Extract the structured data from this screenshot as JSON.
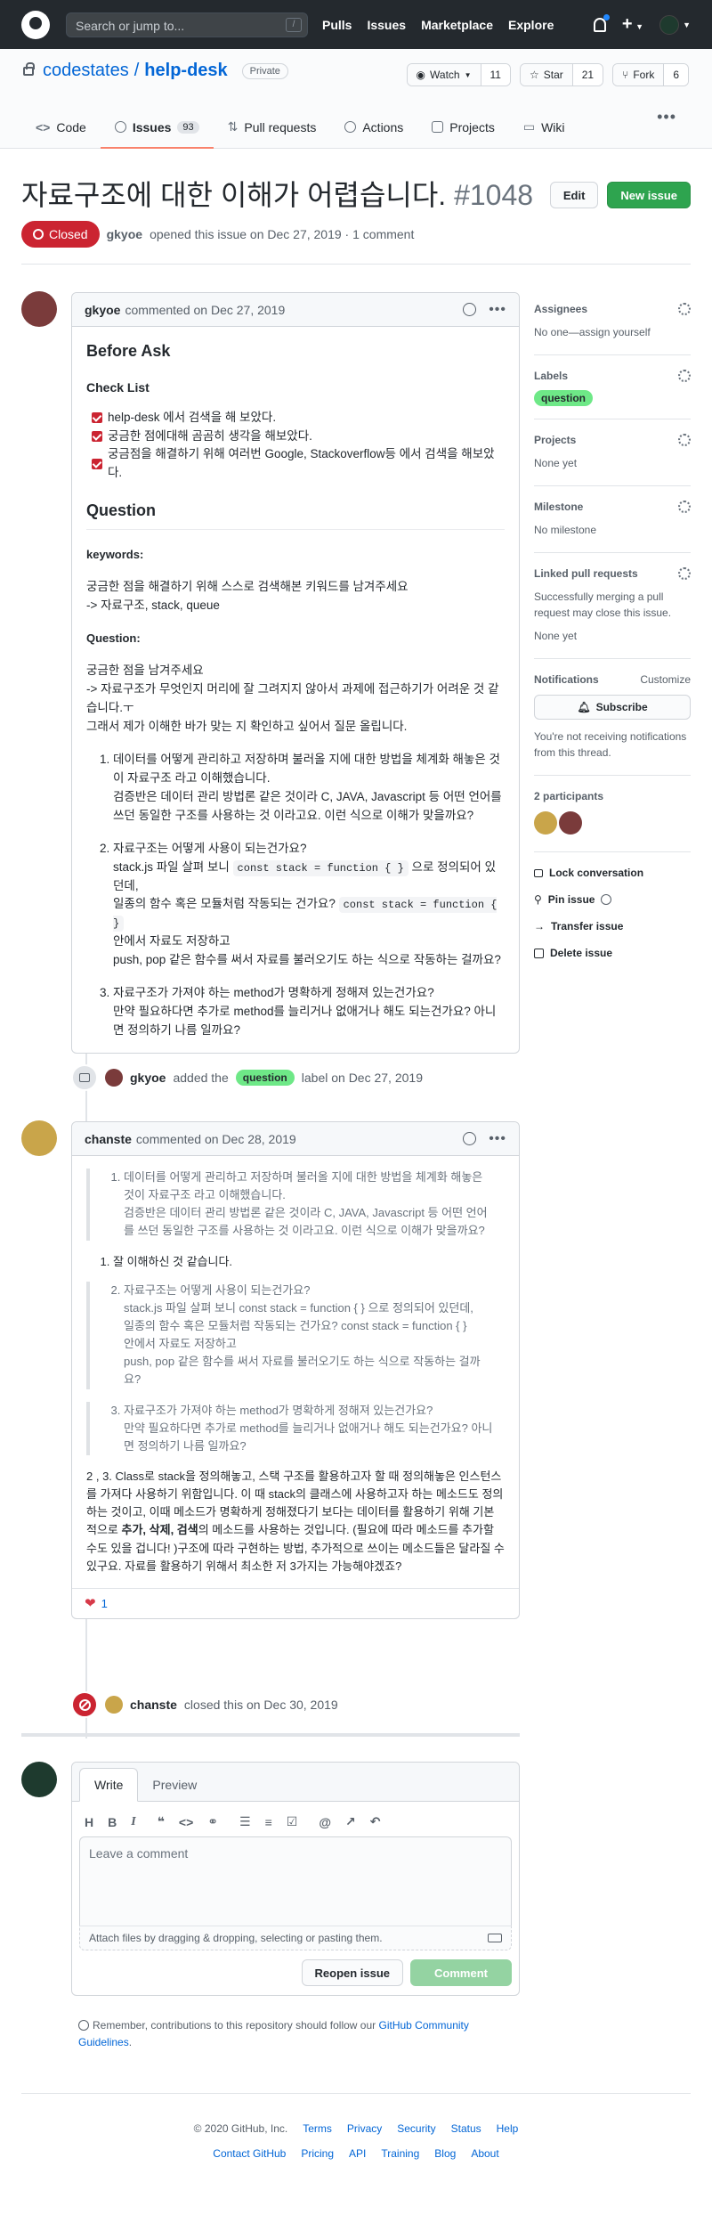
{
  "header": {
    "search_placeholder": "Search or jump to...",
    "slash": "/",
    "nav": [
      "Pulls",
      "Issues",
      "Marketplace",
      "Explore"
    ]
  },
  "repo": {
    "owner": "codestates",
    "name": "help-desk",
    "visibility": "Private",
    "watch": "Watch",
    "watch_count": "11",
    "star": "Star",
    "star_count": "21",
    "fork": "Fork",
    "fork_count": "6"
  },
  "tabs": [
    {
      "label": "Code"
    },
    {
      "label": "Issues",
      "count": "93"
    },
    {
      "label": "Pull requests"
    },
    {
      "label": "Actions"
    },
    {
      "label": "Projects"
    },
    {
      "label": "Wiki"
    }
  ],
  "issue": {
    "title": "자료구조에 대한 이해가 어렵습니다.",
    "number": "#1048",
    "edit": "Edit",
    "new_issue": "New issue",
    "state": "Closed",
    "author": "gkyoe",
    "opened_text": "opened this issue on Dec 27, 2019 · 1 comment"
  },
  "comment1": {
    "author": "gkyoe",
    "meta": "commented on Dec 27, 2019",
    "h_before": "Before Ask",
    "h_checklist": "Check List",
    "checks": [
      "help-desk 에서 검색을 해 보았다.",
      "궁금한 점에대해 곰곰히 생각을 해보았다.",
      "궁금점을 해결하기 위해 여러번 Google, Stackoverflow등 에서 검색을 해보았다."
    ],
    "h_question": "Question",
    "h_keywords": "keywords:",
    "kw1": "궁금한 점을 해결하기 위해 스스로 검색해본 키워드를 남겨주세요",
    "kw2": "-> 자료구조, stack, queue",
    "h_q2": "Question:",
    "q1": "궁금한 점을 남겨주세요",
    "q2": "-> 자료구조가 무엇인지 머리에 잘 그려지지 않아서 과제에 접근하기가 어려운 것 같습니다.ㅜ",
    "q3": "그래서 제가 이해한 바가 맞는 지 확인하고 싶어서 질문 올립니다.",
    "li1a": "데이터를 어떻게 관리하고 저장하며 불러올 지에 대한 방법을 체계화 해놓은 것이 자료구조 라고 이해했습니다.",
    "li1b": "검증반은 데이터 관리 방법론 같은 것이라 C, JAVA, Javascript 등 어떤 언어를 쓰던 동일한 구조를 사용하는 것 이라고요. 이런 식으로 이해가 맞을까요?",
    "li2a": "자료구조는 어떻게 사용이 되는건가요?",
    "li2b": "stack.js 파일 살펴 보니",
    "li2code1": "const stack = function { }",
    "li2c": "으로 정의되어 있던데,",
    "li2d": "일종의 함수 혹은 모듈처럼 작동되는 건가요?",
    "li2code2": "const stack = function { }",
    "li2e": "안에서 자료도 저장하고",
    "li2f": "push, pop 같은 함수를 써서 자료를 불러오기도 하는 식으로 작동하는 걸까요?",
    "li3a": "자료구조가 가져야 하는 method가 명확하게 정해져 있는건가요?",
    "li3b": "만약 필요하다면 추가로 method를 늘리거나 없애거나 해도 되는건가요? 아니면 정의하기 나름 일까요?"
  },
  "event1": {
    "author": "gkyoe",
    "text1": "added the",
    "label": "question",
    "text2": "label on Dec 27, 2019"
  },
  "comment2": {
    "author": "chanste",
    "meta": "commented on Dec 28, 2019",
    "bq1a": "데이터를 어떻게 관리하고 저장하며 불러올 지에 대한 방법을 체계화 해놓은 것이 자료구조 라고 이해했습니다.",
    "bq1b": "검증반은 데이터 관리 방법론 같은 것이라 C, JAVA, Javascript 등 어떤 언어를 쓰던 동일한 구조를 사용하는 것 이라고요. 이런 식으로 이해가 맞을까요?",
    "ans1": "잘 이해하신 것 같습니다.",
    "bq2a": "자료구조는 어떻게 사용이 되는건가요?",
    "bq2b": "stack.js 파일 살펴 보니 const stack = function { } 으로 정의되어 있던데,",
    "bq2c": "일종의 함수 혹은 모듈처럼 작동되는 건가요? const stack = function { }",
    "bq2d": "안에서 자료도 저장하고",
    "bq2e": "push, pop 같은 함수를 써서 자료를 불러오기도 하는 식으로 작동하는 걸까요?",
    "bq3a": "자료구조가 가져야 하는 method가 명확하게 정해져 있는건가요?",
    "bq3b": "만약 필요하다면 추가로 method를 늘리거나 없애거나 해도 되는건가요? 아니면 정의하기 나름 일까요?",
    "ans2a": "2 , 3. Class로 stack을 정의해놓고, 스택 구조를 활용하고자 할 때 정의해놓은 인스턴스를 가져다 사용하기 위함입니다. 이 때 stack의 클래스에 사용하고자 하는 메소드도 정의하는 것이고, 이때 메소드가 명확하게 정해졌다기 보다는 데이터를 활용하기 위해 기본적으로",
    "ans2b": "추가, 삭제, 검색",
    "ans2c": "의 메소드를 사용하는 것입니다. (필요에 따라 메소드를 추가할 수도 있을 겁니다! )구조에 따라 구현하는 방법, 추가적으로 쓰이는 메소드들은 달라질 수 있구요. 자료를 활용하기 위해서 최소한 저 3가지는 가능해야겠죠?",
    "reaction_count": "1"
  },
  "event2": {
    "author": "chanste",
    "text": "closed this on Dec 30, 2019"
  },
  "sidebar": {
    "assignees_h": "Assignees",
    "assignees_v": "No one—assign yourself",
    "labels_h": "Labels",
    "label": "question",
    "projects_h": "Projects",
    "projects_v": "None yet",
    "milestone_h": "Milestone",
    "milestone_v": "No milestone",
    "linked_h": "Linked pull requests",
    "linked_v": "Successfully merging a pull request may close this issue.",
    "linked_v2": "None yet",
    "notif_h": "Notifications",
    "customize": "Customize",
    "subscribe": "Subscribe",
    "notif_v": "You're not receiving notifications from this thread.",
    "participants_h": "2 participants",
    "lock": "Lock conversation",
    "pin": "Pin issue",
    "transfer": "Transfer issue",
    "delete": "Delete issue"
  },
  "compose": {
    "write": "Write",
    "preview": "Preview",
    "placeholder": "Leave a comment",
    "attach": "Attach files by dragging & dropping, selecting or pasting them.",
    "reopen": "Reopen issue",
    "comment": "Comment"
  },
  "remember": {
    "text": "Remember, contributions to this repository should follow our",
    "link": "GitHub Community Guidelines",
    "end": "."
  },
  "footer": {
    "copyright": "© 2020 GitHub, Inc.",
    "row1": [
      "Terms",
      "Privacy",
      "Security",
      "Status",
      "Help"
    ],
    "row2": [
      "Contact GitHub",
      "Pricing",
      "API",
      "Training",
      "Blog",
      "About"
    ]
  },
  "colors": {
    "accent": "#0366d6",
    "closed": "#cb2431",
    "green": "#2ea44f",
    "label_question": "#6ee887"
  }
}
